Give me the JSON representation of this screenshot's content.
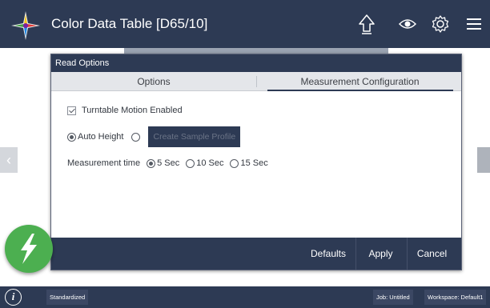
{
  "app": {
    "title": "Color Data Table [D65/10]"
  },
  "topbar": {
    "icons": [
      "upload-icon",
      "eye-icon",
      "gear-icon",
      "menu-icon"
    ]
  },
  "dialog": {
    "title": "Read Options",
    "tabs": [
      {
        "label": "Options",
        "active": false
      },
      {
        "label": "Measurement Configuration",
        "active": true
      }
    ],
    "turntable": {
      "label": "Turntable Motion Enabled",
      "checked": true
    },
    "height": {
      "auto_label": "Auto Height",
      "selected": "auto",
      "create_profile_label": "Create Sample Profile"
    },
    "measurement_time": {
      "label": "Measurement time",
      "options": [
        "5 Sec",
        "10 Sec",
        "15 Sec"
      ],
      "selected": "5 Sec"
    },
    "footer": {
      "defaults": "Defaults",
      "apply": "Apply",
      "cancel": "Cancel"
    }
  },
  "statusbar": {
    "info_icon": "i",
    "mode": "Standardized",
    "job": "Job: Untitled",
    "workspace": "Workspace: Default1"
  },
  "colors": {
    "primary": "#2d3a54",
    "measure": "#4caf50"
  }
}
